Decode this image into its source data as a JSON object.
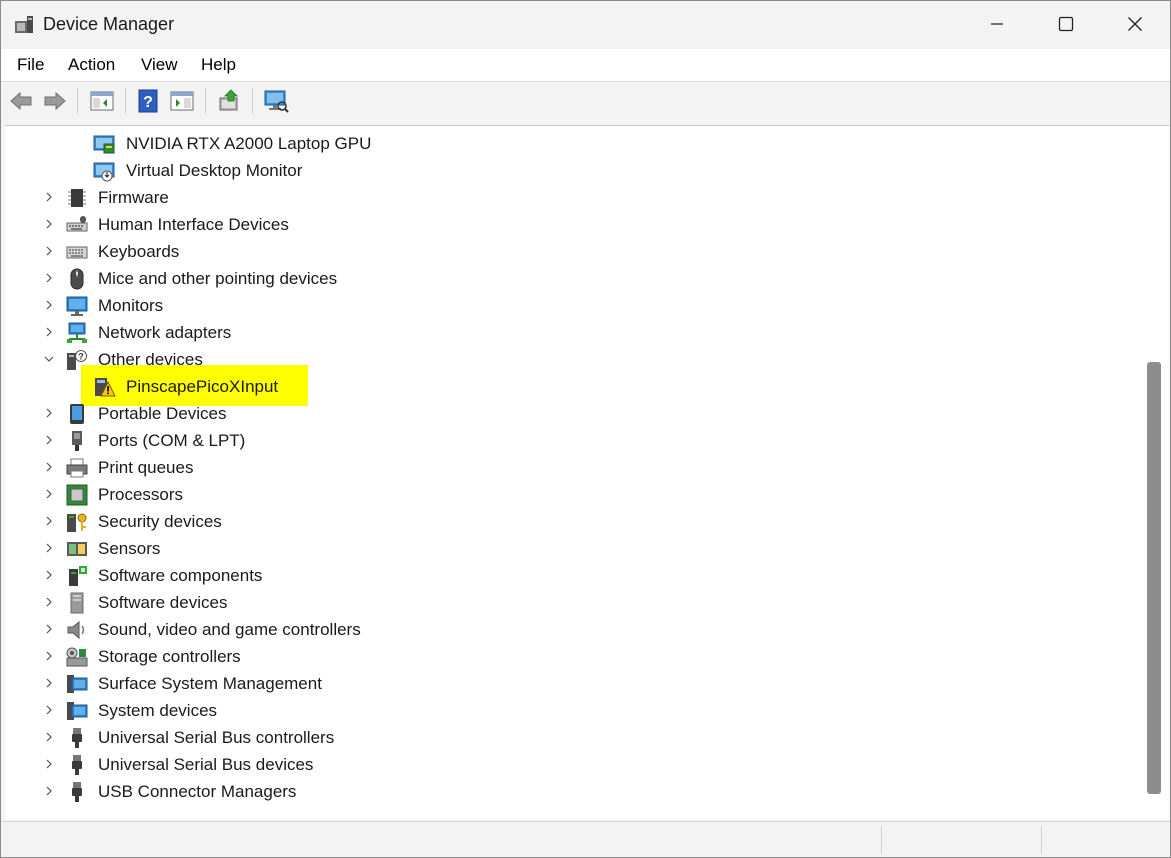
{
  "window": {
    "title": "Device Manager"
  },
  "menubar": {
    "items": [
      "File",
      "Action",
      "View",
      "Help"
    ]
  },
  "toolbar": {
    "buttons": [
      "back-arrow-icon",
      "forward-arrow-icon",
      "show-hide-console-tree-icon",
      "help-icon",
      "properties-icon",
      "update-driver-icon",
      "scan-hardware-icon"
    ]
  },
  "tree": {
    "rows": [
      {
        "label": "NVIDIA RTX A2000 Laptop GPU",
        "icon": "display-adapter-icon",
        "level": 2
      },
      {
        "label": "Virtual Desktop Monitor",
        "icon": "display-adapter-icon",
        "level": 2
      },
      {
        "label": "Firmware",
        "icon": "firmware-icon",
        "level": 1,
        "expanded": false
      },
      {
        "label": "Human Interface Devices",
        "icon": "hid-icon",
        "level": 1,
        "expanded": false
      },
      {
        "label": "Keyboards",
        "icon": "keyboard-icon",
        "level": 1,
        "expanded": false
      },
      {
        "label": "Mice and other pointing devices",
        "icon": "mouse-icon",
        "level": 1,
        "expanded": false
      },
      {
        "label": "Monitors",
        "icon": "monitor-icon",
        "level": 1,
        "expanded": false
      },
      {
        "label": "Network adapters",
        "icon": "network-icon",
        "level": 1,
        "expanded": false
      },
      {
        "label": "Other devices",
        "icon": "unknown-device-icon",
        "level": 1,
        "expanded": true
      },
      {
        "label": "PinscapePicoXInput",
        "icon": "warning-device-icon",
        "level": 2
      },
      {
        "label": "Portable Devices",
        "icon": "portable-device-icon",
        "level": 1,
        "expanded": false
      },
      {
        "label": "Ports (COM & LPT)",
        "icon": "port-icon",
        "level": 1,
        "expanded": false
      },
      {
        "label": "Print queues",
        "icon": "printer-icon",
        "level": 1,
        "expanded": false
      },
      {
        "label": "Processors",
        "icon": "processor-icon",
        "level": 1,
        "expanded": false
      },
      {
        "label": "Security devices",
        "icon": "security-key-icon",
        "level": 1,
        "expanded": false
      },
      {
        "label": "Sensors",
        "icon": "sensor-icon",
        "level": 1,
        "expanded": false
      },
      {
        "label": "Software components",
        "icon": "software-component-icon",
        "level": 1,
        "expanded": false
      },
      {
        "label": "Software devices",
        "icon": "software-device-icon",
        "level": 1,
        "expanded": false
      },
      {
        "label": "Sound, video and game controllers",
        "icon": "speaker-icon",
        "level": 1,
        "expanded": false
      },
      {
        "label": "Storage controllers",
        "icon": "storage-icon",
        "level": 1,
        "expanded": false
      },
      {
        "label": "Surface System Management",
        "icon": "system-icon",
        "level": 1,
        "expanded": false
      },
      {
        "label": "System devices",
        "icon": "system-icon",
        "level": 1,
        "expanded": false
      },
      {
        "label": "Universal Serial Bus controllers",
        "icon": "usb-icon",
        "level": 1,
        "expanded": false
      },
      {
        "label": "Universal Serial Bus devices",
        "icon": "usb-icon",
        "level": 1,
        "expanded": false
      },
      {
        "label": "USB Connector Managers",
        "icon": "usb-icon",
        "level": 1,
        "expanded": false
      }
    ]
  },
  "colors": {
    "highlight": "#ffff00",
    "window_bg": "#f3f3f3",
    "tree_bg": "#ffffff",
    "scroll_thumb": "#8d8d8d"
  }
}
